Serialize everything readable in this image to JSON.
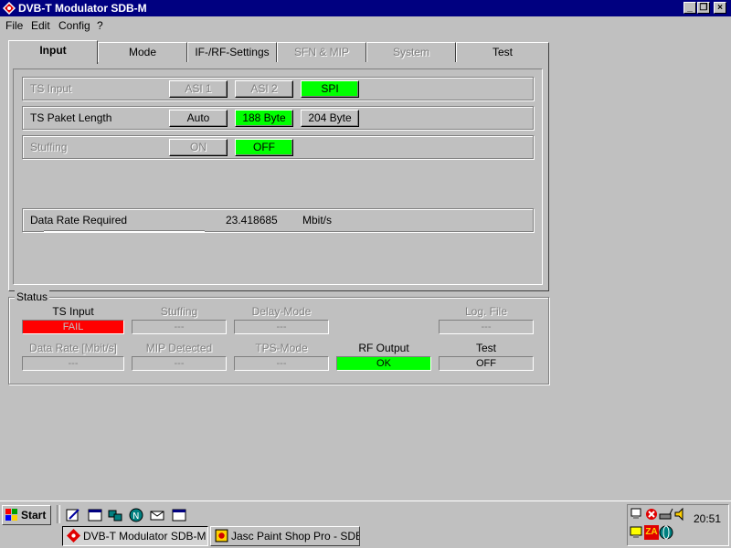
{
  "window": {
    "title": "DVB-T Modulator SDB-M",
    "minimize_glyph": "_",
    "restore_glyph": "❐",
    "close_glyph": "×"
  },
  "menu": [
    "File",
    "Edit",
    "Config",
    "?"
  ],
  "tabs": [
    {
      "label": "Input",
      "state": "active"
    },
    {
      "label": "Mode",
      "state": "normal"
    },
    {
      "label": "IF-/RF-Settings",
      "state": "normal"
    },
    {
      "label": "SFN & MIP",
      "state": "disabled"
    },
    {
      "label": "System",
      "state": "disabled"
    },
    {
      "label": "Test",
      "state": "normal"
    }
  ],
  "input_panel": {
    "ts_input": {
      "label": "TS Input",
      "options": [
        "ASI 1",
        "ASI 2",
        "SPI"
      ],
      "selected": "SPI",
      "enabled": false
    },
    "ts_packet_length": {
      "label": "TS Paket Length",
      "options": [
        "Auto",
        "188 Byte",
        "204 Byte"
      ],
      "selected": "188 Byte",
      "enabled": true
    },
    "stuffing": {
      "label": "Stuffing",
      "options": [
        "ON",
        "OFF"
      ],
      "selected": "OFF",
      "enabled": false
    },
    "data_rate": {
      "label": "Data Rate Required",
      "value": "23.418685",
      "unit": "Mbit/s"
    }
  },
  "status": {
    "legend": "Status",
    "fields": [
      {
        "label": "TS Input",
        "value": "FAIL",
        "style": "red",
        "label_enabled": true
      },
      {
        "label": "Stuffing",
        "value": "---",
        "style": "gray",
        "label_enabled": false
      },
      {
        "label": "Delay-Mode",
        "value": "---",
        "style": "gray",
        "label_enabled": false
      },
      {
        "label": "Log. File",
        "value": "---",
        "style": "gray",
        "label_enabled": false
      },
      {
        "label": "Data Rate [Mbit/s]",
        "value": "---",
        "style": "gray",
        "label_enabled": false
      },
      {
        "label": "MIP Detected",
        "value": "---",
        "style": "gray",
        "label_enabled": false
      },
      {
        "label": "TPS-Mode",
        "value": "---",
        "style": "gray",
        "label_enabled": false
      },
      {
        "label": "RF Output",
        "value": "OK",
        "style": "green",
        "label_enabled": true
      },
      {
        "label": "Test",
        "value": "OFF",
        "style": "normal",
        "label_enabled": true
      }
    ]
  },
  "taskbar": {
    "start_label": "Start",
    "tasks": [
      {
        "label": "DVB-T Modulator SDB-M",
        "active": true
      },
      {
        "label": "Jasc Paint Shop Pro - SDB...",
        "active": false
      }
    ],
    "clock": "20:51",
    "tray_text": "ZA"
  },
  "colors": {
    "title_bar": "#000080",
    "selected_green": "#00ff00",
    "fail_red": "#ff0000",
    "face": "#c0c0c0"
  }
}
